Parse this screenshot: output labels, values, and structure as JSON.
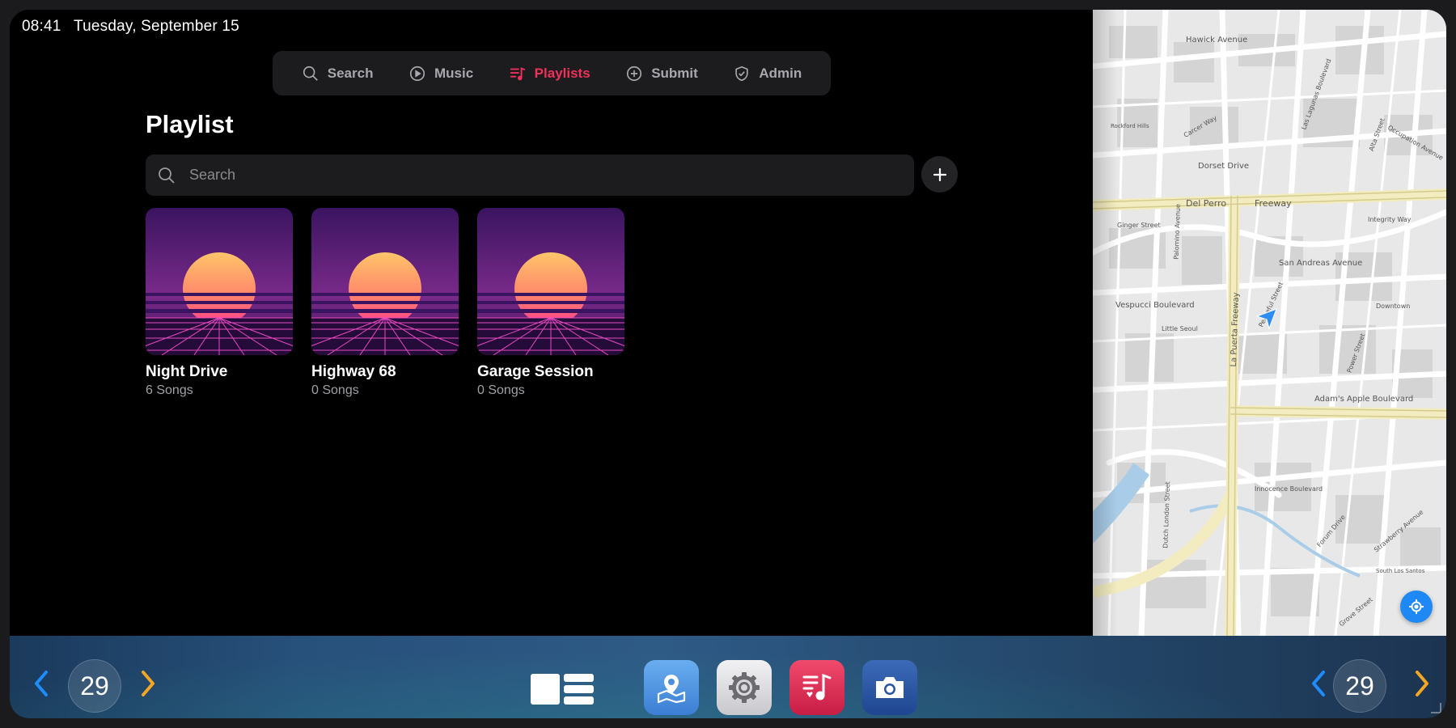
{
  "status": {
    "time": "08:41",
    "date": "Tuesday, September 15"
  },
  "nav": [
    {
      "label": "Search",
      "icon": "search-icon",
      "active": false
    },
    {
      "label": "Music",
      "icon": "play-circle-icon",
      "active": false
    },
    {
      "label": "Playlists",
      "icon": "playlist-icon",
      "active": true
    },
    {
      "label": "Submit",
      "icon": "plus-circle-icon",
      "active": false
    },
    {
      "label": "Admin",
      "icon": "shield-check-icon",
      "active": false
    }
  ],
  "page": {
    "title": "Playlist",
    "search_placeholder": "Search"
  },
  "playlists": [
    {
      "title": "Night Drive",
      "subtitle": "6 Songs"
    },
    {
      "title": "Highway 68",
      "subtitle": "0 Songs"
    },
    {
      "title": "Garage Session",
      "subtitle": "0 Songs"
    }
  ],
  "map": {
    "labels": [
      "Hawick Avenue",
      "Dorset Drive",
      "Del Perro",
      "Freeway",
      "Ginger Street",
      "San Andreas Avenue",
      "Vespucci Boulevard",
      "La Puerta Freeway",
      "Adam's Apple Boulevard",
      "Innocence Boulevard",
      "Power Street",
      "Alta Street",
      "Palomino Avenue",
      "Las Lagunas Boulevard",
      "Integrity Way",
      "Occupation Avenue",
      "Peaceful Street",
      "Little Seoul",
      "Downtown",
      "Carcer Way",
      "Forum Drive",
      "Strawberry Avenue",
      "South Los Santos",
      "Grove Street",
      "Rockford Hills",
      "Dutch London Street"
    ]
  },
  "dock": {
    "left_temp": "29",
    "right_temp": "29",
    "apps": [
      "maps-icon",
      "settings-icon",
      "music-icon",
      "camera-icon"
    ]
  },
  "colors": {
    "accent": "#f0325a",
    "map_button": "#1e88f5",
    "chevron_left": "#1e8cff",
    "chevron_right": "#f5a623"
  }
}
